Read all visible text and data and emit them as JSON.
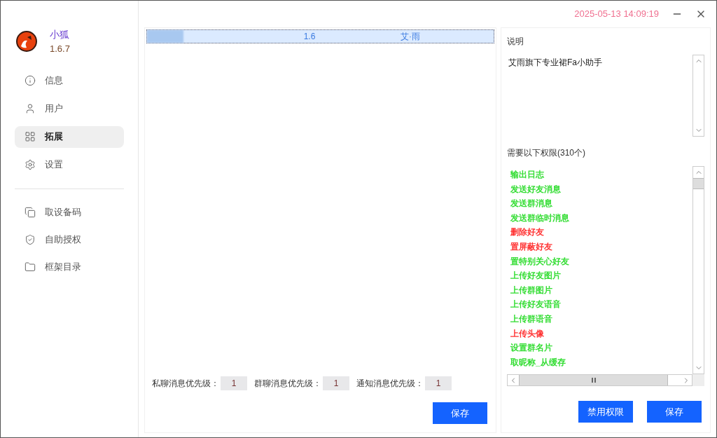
{
  "app": {
    "name": "小狐",
    "version": "1.6.7"
  },
  "nav": [
    {
      "label": "信息",
      "selected": false
    },
    {
      "label": "用户",
      "selected": false
    },
    {
      "label": "拓展",
      "selected": true
    },
    {
      "label": "设置",
      "selected": false
    }
  ],
  "tools": [
    {
      "label": "取设备码"
    },
    {
      "label": "自助授权"
    },
    {
      "label": "框架目录"
    }
  ],
  "titlebar": {
    "datetime": "2025-05-13 14:09:19"
  },
  "plugins": [
    {
      "version": "1.6",
      "author": "艾·雨",
      "selected": true
    }
  ],
  "priorities": [
    {
      "label": "私聊消息优先级：",
      "value": "1"
    },
    {
      "label": "群聊消息优先级：",
      "value": "1"
    },
    {
      "label": "通知消息优先级：",
      "value": "1"
    }
  ],
  "save_label": "保存",
  "details": {
    "description_title": "说明",
    "description": "艾雨旗下专业裙Fa小助手",
    "permissions_title": "需要以下权限(310个)",
    "permissions": [
      {
        "label": "输出日志",
        "color": "#33dd33"
      },
      {
        "label": "发送好友消息",
        "color": "#33dd33"
      },
      {
        "label": "发送群消息",
        "color": "#33dd33"
      },
      {
        "label": "发送群临时消息",
        "color": "#33dd33"
      },
      {
        "label": "删除好友",
        "color": "#ff3333"
      },
      {
        "label": "置屏蔽好友",
        "color": "#ff3333"
      },
      {
        "label": "置特别关心好友",
        "color": "#33dd33"
      },
      {
        "label": "上传好友图片",
        "color": "#33dd33"
      },
      {
        "label": "上传群图片",
        "color": "#33dd33"
      },
      {
        "label": "上传好友语音",
        "color": "#33dd33"
      },
      {
        "label": "上传群语音",
        "color": "#33dd33"
      },
      {
        "label": "上传头像",
        "color": "#ff3333"
      },
      {
        "label": "设置群名片",
        "color": "#33dd33"
      },
      {
        "label": "取昵称_从缓存",
        "color": "#33dd33"
      }
    ],
    "buttons": [
      "禁用权限",
      "保存"
    ]
  }
}
